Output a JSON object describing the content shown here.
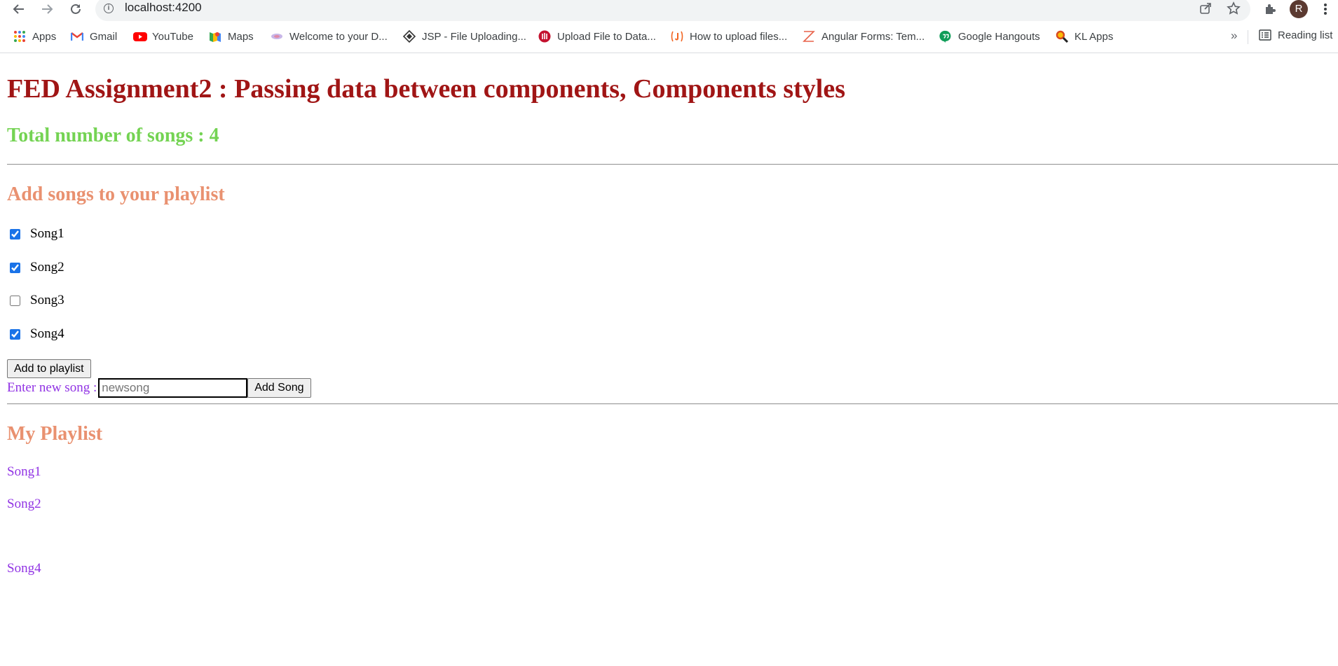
{
  "browser": {
    "url": "localhost:4200",
    "avatar_letter": "R",
    "bookmarks": [
      {
        "label": "Apps",
        "icon": "apps-grid-icon"
      },
      {
        "label": "Gmail",
        "icon": "gmail-icon"
      },
      {
        "label": "YouTube",
        "icon": "youtube-icon"
      },
      {
        "label": "Maps",
        "icon": "maps-icon"
      },
      {
        "label": "Welcome to your D...",
        "icon": "welcome-site-icon"
      },
      {
        "label": "JSP - File Uploading...",
        "icon": "jsp-site-icon"
      },
      {
        "label": "Upload File to Data...",
        "icon": "upload-site-icon"
      },
      {
        "label": "How to upload files...",
        "icon": "javatpoint-icon"
      },
      {
        "label": "Angular Forms: Tem...",
        "icon": "angular-forms-icon"
      },
      {
        "label": "Google Hangouts",
        "icon": "hangouts-icon"
      },
      {
        "label": "KL Apps",
        "icon": "kl-apps-icon"
      }
    ],
    "overflow_label": "»",
    "reading_list_label": "Reading list"
  },
  "page": {
    "title": "FED Assignment2 : Passing data between components, Components styles",
    "total_songs": "Total number of songs : 4",
    "add_section_title": "Add songs to your playlist",
    "songs": [
      {
        "label": "Song1",
        "checked": true
      },
      {
        "label": "Song2",
        "checked": true
      },
      {
        "label": "Song3",
        "checked": false
      },
      {
        "label": "Song4",
        "checked": true
      }
    ],
    "add_to_playlist_label": "Add to playlist",
    "new_song_label": "Enter new song :",
    "new_song_placeholder": "newsong",
    "new_song_value": "",
    "add_song_label": "Add Song",
    "playlist_title": "My Playlist",
    "playlist": [
      "Song1",
      "Song2",
      "",
      "Song4"
    ]
  },
  "colors": {
    "title": "#a01515",
    "total": "#74d353",
    "section_title": "#e99170",
    "playlist_text": "#9133e4"
  }
}
